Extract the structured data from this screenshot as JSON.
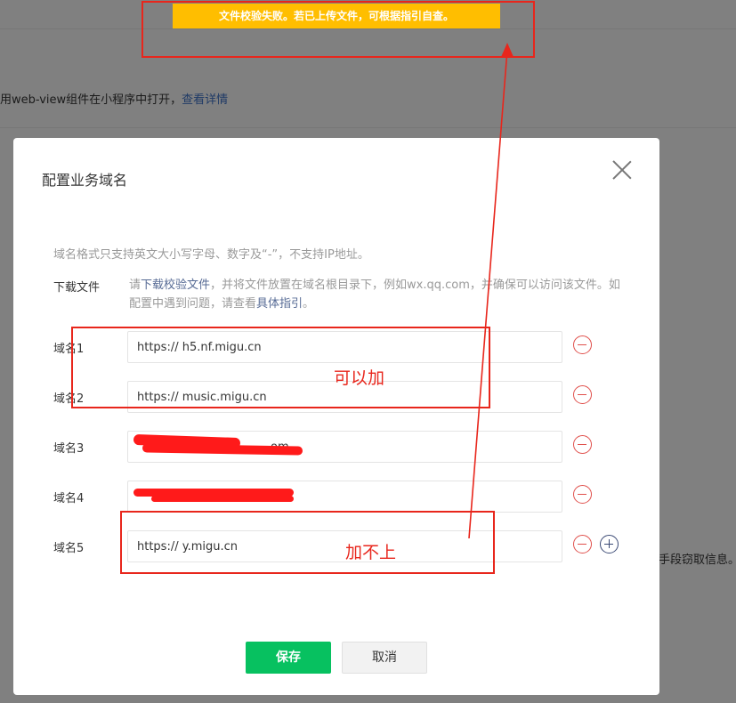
{
  "background": {
    "intro_text": "用web-view组件在小程序中打开，",
    "intro_link": "查看详情",
    "right_text": "手段窃取信息。"
  },
  "toast": {
    "message": "文件校验失败。若已上传文件，可根据指引自查。"
  },
  "modal": {
    "title": "配置业务域名",
    "hint": "域名格式只支持英文大小写字母、数字及“-”，不支持IP地址。",
    "download": {
      "label": "下载文件",
      "desc_prefix": "请",
      "desc_link": "下载校验文件",
      "desc_middle": "，并将文件放置在域名根目录下，例如wx.qq.com，并确保可以访问该文件。如配置中遇到问题，请查看",
      "desc_link2": "具体指引",
      "desc_suffix": "。"
    },
    "domains": [
      {
        "label": "域名1",
        "value": "https:// h5.nf.migu.cn"
      },
      {
        "label": "域名2",
        "value": "https:// music.migu.cn"
      },
      {
        "label": "域名3",
        "value": "om"
      },
      {
        "label": "域名4",
        "value": ""
      },
      {
        "label": "域名5",
        "value": "https:// y.migu.cn"
      }
    ],
    "save_label": "保存",
    "cancel_label": "取消"
  },
  "annotations": {
    "ok": "可以加",
    "fail": "加不上",
    "color": "#e8261c"
  },
  "colors": {
    "toast": "#ffbe00",
    "primary": "#07c160",
    "danger": "#e0504c",
    "link": "#576b95"
  }
}
